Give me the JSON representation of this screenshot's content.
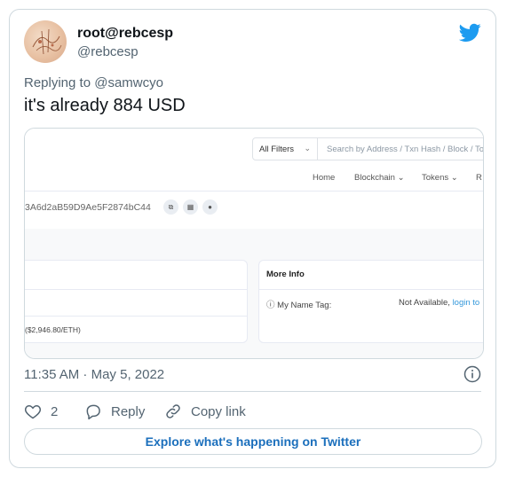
{
  "user": {
    "name": "root@rebcesp",
    "handle": "@rebcesp"
  },
  "tweet": {
    "replying_prefix": "Replying to",
    "replying_to": "@samwcyo",
    "text": "it's already 884 USD",
    "timestamp": "11:35 AM · May 5, 2022"
  },
  "screenshot": {
    "filter_label": "All Filters",
    "search_placeholder": "Search by Address / Txn Hash / Block / To",
    "nav": [
      "Home",
      "Blockchain ⌄",
      "Tokens ⌄",
      "R"
    ],
    "address": "3A6d2aB59D9Ae5F2874bC44",
    "eth_price": "($2,946.80/ETH)",
    "more_info_title": "More Info",
    "name_tag_label": "My Name Tag:",
    "not_available": "Not Available,",
    "login_link": "login to"
  },
  "actions": {
    "like_count": "2",
    "reply_label": "Reply",
    "copy_label": "Copy link"
  },
  "footer": {
    "explore_label": "Explore what's happening on Twitter"
  },
  "colors": {
    "twitter_blue": "#1d9bf0",
    "link_blue": "#1b6fbc",
    "muted": "#536471"
  },
  "icons": [
    "twitter-bird-icon",
    "info-icon",
    "heart-icon",
    "reply-icon",
    "link-icon",
    "copy-icon",
    "grid-icon",
    "comment-icon"
  ]
}
